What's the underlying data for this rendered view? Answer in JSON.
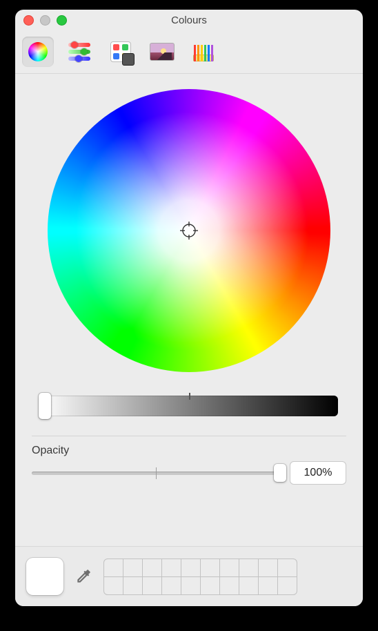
{
  "window": {
    "title": "Colours"
  },
  "toolbar": {
    "items": [
      {
        "name": "colour-wheel-tab",
        "icon": "colour-wheel-icon",
        "selected": true
      },
      {
        "name": "colour-sliders-tab",
        "icon": "sliders-icon",
        "selected": false
      },
      {
        "name": "colour-palettes-tab",
        "icon": "palette-icon",
        "selected": false
      },
      {
        "name": "image-palettes-tab",
        "icon": "image-icon",
        "selected": false
      },
      {
        "name": "pencils-tab",
        "icon": "pencils-icon",
        "selected": false
      }
    ]
  },
  "colour_wheel": {
    "selected_hue_deg": 0,
    "selected_saturation_pct": 0,
    "crosshair_position": "center"
  },
  "brightness": {
    "value_pct": 100,
    "thumb_position": "left"
  },
  "opacity": {
    "label": "Opacity",
    "value_display": "100%",
    "value_pct": 100
  },
  "current_colour": "#FFFFFF",
  "swatch_grid": {
    "rows": 2,
    "cols": 10,
    "cells": [
      null,
      null,
      null,
      null,
      null,
      null,
      null,
      null,
      null,
      null,
      null,
      null,
      null,
      null,
      null,
      null,
      null,
      null,
      null,
      null
    ]
  }
}
